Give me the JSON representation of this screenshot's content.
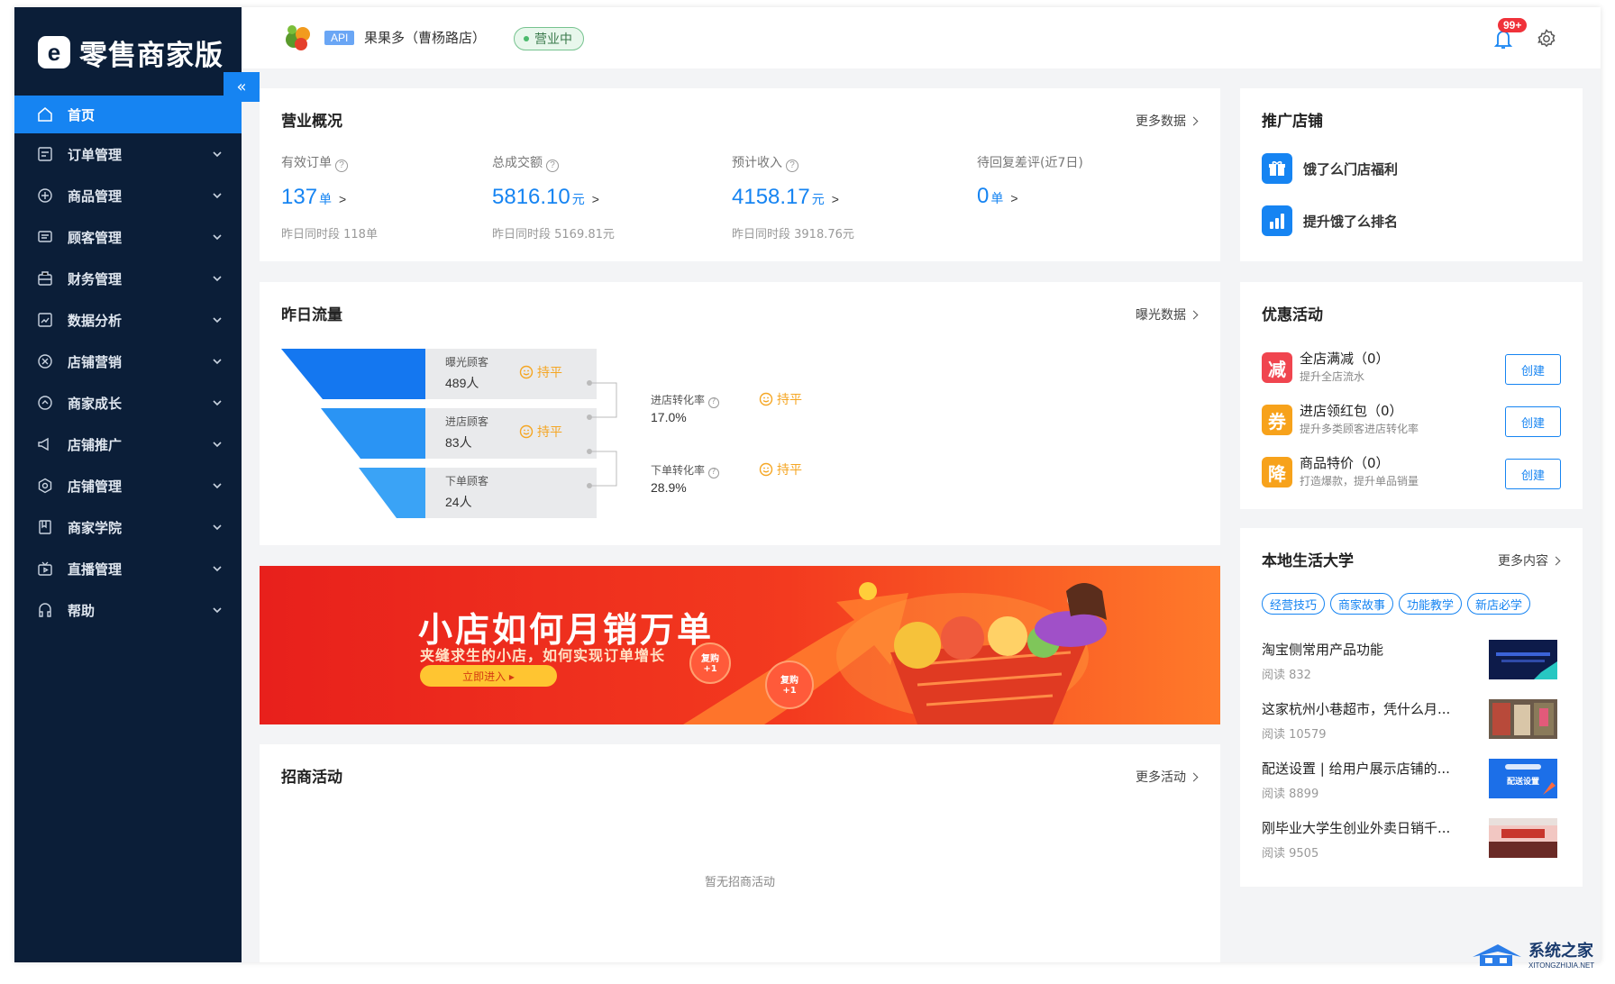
{
  "app": {
    "logo_mark": "e",
    "logo_text": "零售商家版"
  },
  "sidebar": {
    "collapse_icon": "chevrons-left-icon",
    "items": [
      {
        "label": "首页",
        "icon": "home-icon",
        "active": true
      },
      {
        "label": "订单管理",
        "icon": "order-icon"
      },
      {
        "label": "商品管理",
        "icon": "product-icon"
      },
      {
        "label": "顾客管理",
        "icon": "customer-icon"
      },
      {
        "label": "财务管理",
        "icon": "finance-icon"
      },
      {
        "label": "数据分析",
        "icon": "analytics-icon"
      },
      {
        "label": "店铺营销",
        "icon": "marketing-icon"
      },
      {
        "label": "商家成长",
        "icon": "growth-icon"
      },
      {
        "label": "店铺推广",
        "icon": "promotion-icon"
      },
      {
        "label": "店铺管理",
        "icon": "settings-icon"
      },
      {
        "label": "商家学院",
        "icon": "academy-icon"
      },
      {
        "label": "直播管理",
        "icon": "live-icon"
      },
      {
        "label": "帮助",
        "icon": "help-icon"
      }
    ]
  },
  "topbar": {
    "api_badge": "API",
    "store_name": "果果多（曹杨路店）",
    "status": "营业中",
    "notification_count": "99+"
  },
  "overview": {
    "title": "营业概况",
    "more": "更多数据",
    "kpis": [
      {
        "label": "有效订单",
        "value": "137",
        "unit": "单",
        "yesterday": "昨日同时段 118单",
        "help": true
      },
      {
        "label": "总成交额",
        "value": "5816.10",
        "unit": "元",
        "yesterday": "昨日同时段 5169.81元",
        "help": true
      },
      {
        "label": "预计收入",
        "value": "4158.17",
        "unit": "元",
        "yesterday": "昨日同时段 3918.76元",
        "help": true
      },
      {
        "label": "待回复差评(近7日)",
        "value": "0",
        "unit": "单",
        "yesterday": "",
        "help": false
      }
    ],
    "arrow": ">"
  },
  "traffic": {
    "title": "昨日流量",
    "more": "曝光数据",
    "stages": [
      {
        "label": "曝光顾客",
        "value": "489人",
        "trend": "持平"
      },
      {
        "label": "进店顾客",
        "value": "83人",
        "trend": "持平"
      },
      {
        "label": "下单顾客",
        "value": "24人",
        "trend": ""
      }
    ],
    "conversions": [
      {
        "label": "进店转化率",
        "value": "17.0%",
        "trend": "持平"
      },
      {
        "label": "下单转化率",
        "value": "28.9%",
        "trend": "持平"
      }
    ],
    "colors": {
      "stage1": "#1477f0",
      "stage2": "#2a94f4",
      "stage3": "#3aa3f6",
      "trend": "#f5a623"
    }
  },
  "banner": {
    "title": "小店如何月销万单",
    "subtitle": "夹缝求生的小店，如何实现订单增长",
    "cta": "立即进入 ▸",
    "badge1": "复购\n+1",
    "badge2": "复购\n+1"
  },
  "recruit": {
    "title": "招商活动",
    "more": "更多活动",
    "empty": "暂无招商活动"
  },
  "promote": {
    "title": "推广店铺",
    "links": [
      {
        "label": "饿了么门店福利",
        "icon": "gift-icon"
      },
      {
        "label": "提升饿了么排名",
        "icon": "bar-chart-icon"
      }
    ]
  },
  "discounts": {
    "title": "优惠活动",
    "items": [
      {
        "glyph": "减",
        "name": "全店满减（0）",
        "desc": "提升全店流水",
        "button": "创建",
        "color": "#f0454f"
      },
      {
        "glyph": "券",
        "name": "进店领红包（0）",
        "desc": "提升多类顾客进店转化率",
        "button": "创建",
        "color": "#f7a21b"
      },
      {
        "glyph": "降",
        "name": "商品特价（0）",
        "desc": "打造爆款，提升单品销量",
        "button": "创建",
        "color": "#f7a21b"
      }
    ]
  },
  "university": {
    "title": "本地生活大学",
    "more": "更多内容",
    "tags": [
      "经营技巧",
      "商家故事",
      "功能教学",
      "新店必学"
    ],
    "articles": [
      {
        "title": "淘宝侧常用产品功能",
        "reads": "阅读 832"
      },
      {
        "title": "这家杭州小巷超市，凭什么月...",
        "reads": "阅读 10579"
      },
      {
        "title": "配送设置 | 给用户展示店铺的...",
        "reads": "阅读 8899",
        "thumb_text": "配送设置"
      },
      {
        "title": "刚毕业大学生创业外卖日销千...",
        "reads": "阅读 9505"
      }
    ]
  },
  "watermark": {
    "name": "系统之家",
    "url": "XITONGZHIJIA.NET"
  }
}
